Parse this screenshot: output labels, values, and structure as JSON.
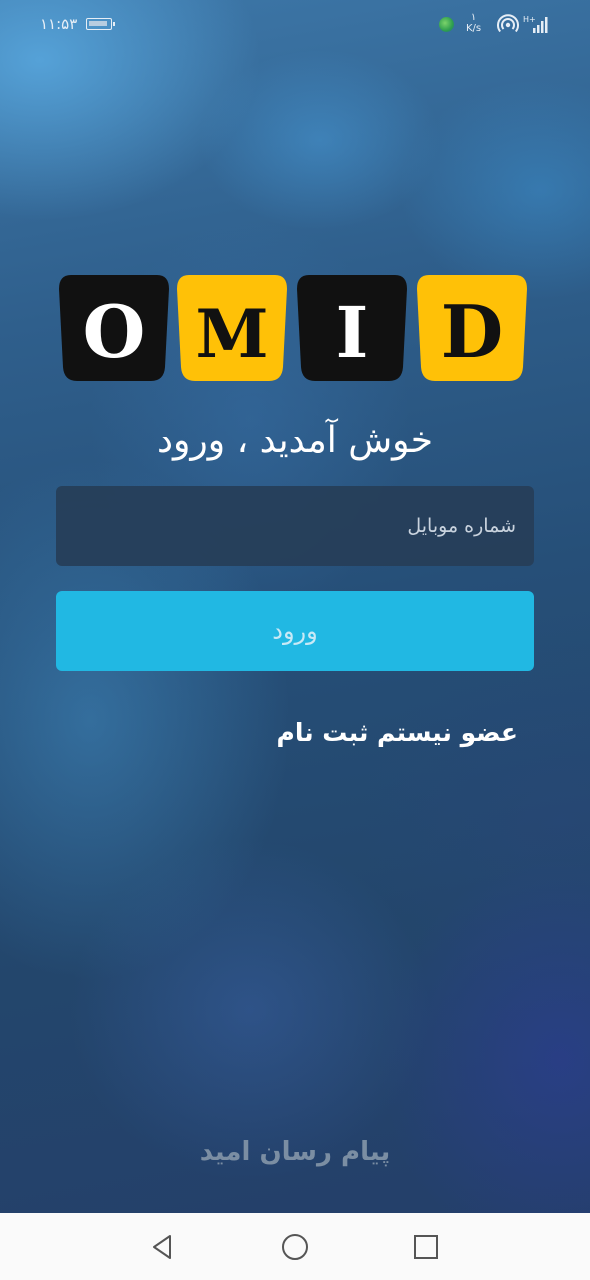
{
  "status_bar": {
    "time": "۱۱:۵۳",
    "net_speed_value": "۱",
    "net_speed_unit": "K/s",
    "icons": [
      "battery-icon",
      "app-notification-icon",
      "hotspot-icon",
      "signal-icon"
    ]
  },
  "logo": {
    "letters": [
      "O",
      "M",
      "I",
      "D"
    ],
    "tile_colors": [
      "#111111",
      "#ffc107",
      "#111111",
      "#ffc107"
    ],
    "letter_colors": [
      "#ffffff",
      "#111111",
      "#ffffff",
      "#111111"
    ]
  },
  "welcome": {
    "title": "خوش آمدید ، ورود"
  },
  "login_form": {
    "phone_placeholder": "شماره موبایل",
    "phone_value": "",
    "submit_label": "ورود",
    "register_link": "عضو نیستم ثبت نام"
  },
  "footer": {
    "brand": "پیام رسان امید"
  },
  "nav_bar": {
    "buttons": [
      "back-icon",
      "home-icon",
      "recents-icon"
    ]
  },
  "colors": {
    "accent": "#21b8e3",
    "logo_yellow": "#ffc107",
    "logo_black": "#111111",
    "input_bg": "#263e58",
    "footer_text": "#7b8ea3"
  }
}
